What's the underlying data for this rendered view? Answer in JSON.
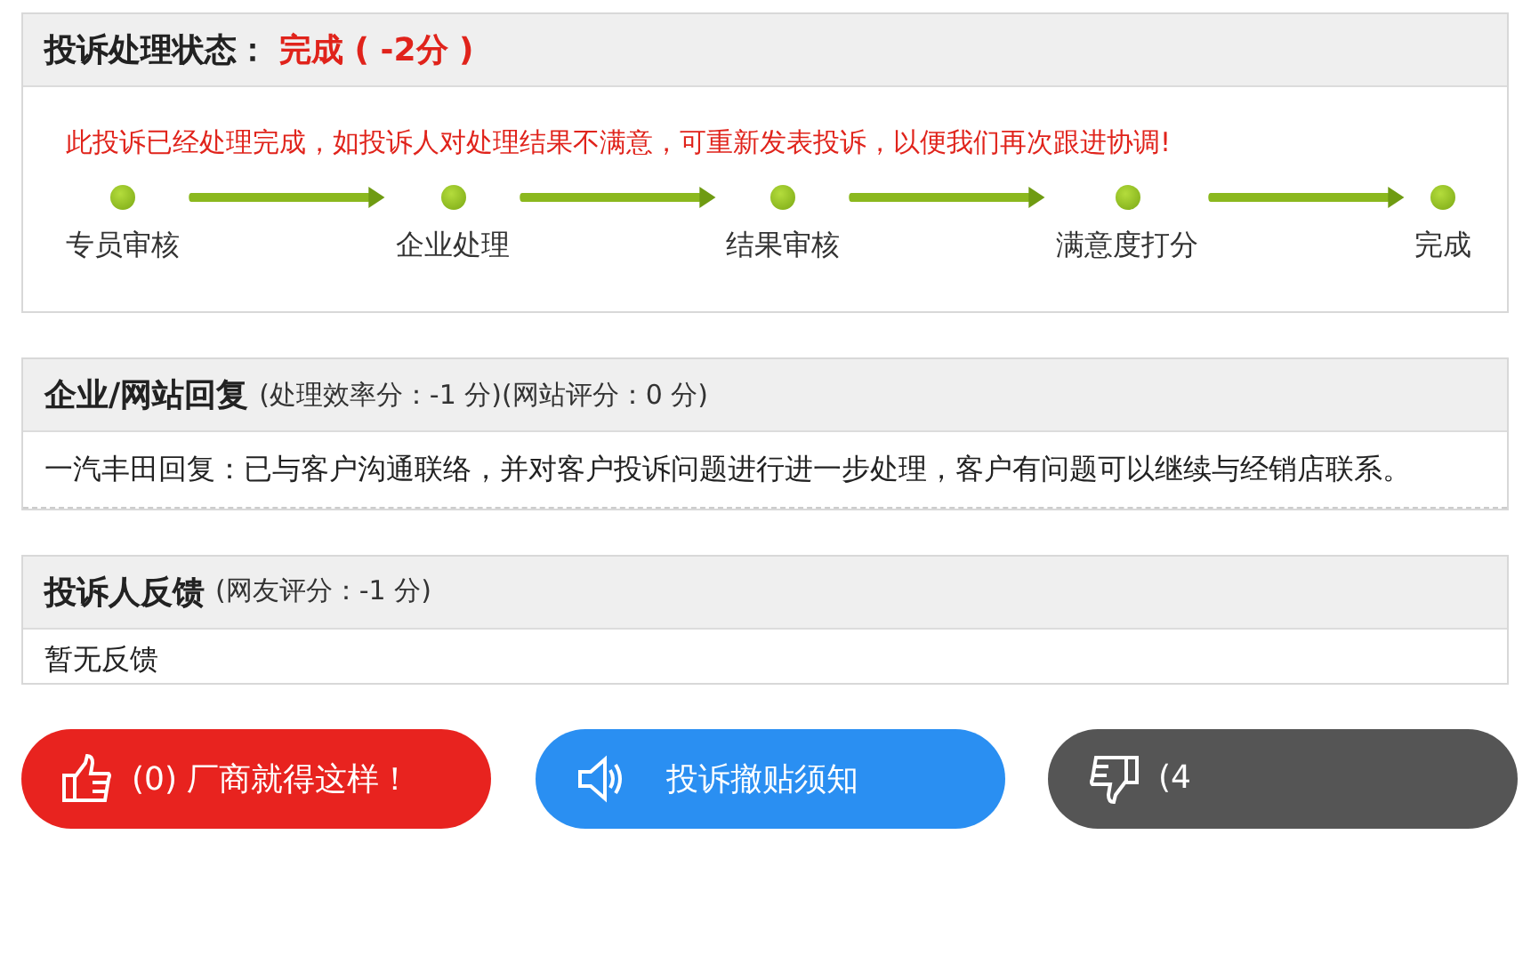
{
  "status_panel": {
    "title": "投诉处理状态：",
    "status": "完成 ( -2分 )",
    "notice": "此投诉已经处理完成，如投诉人对处理结果不满意，可重新发表投诉，以便我们再次跟进协调!",
    "steps": [
      {
        "label": "专员审核",
        "done": true
      },
      {
        "label": "企业处理",
        "done": true
      },
      {
        "label": "结果审核",
        "done": true
      },
      {
        "label": "满意度打分",
        "done": true
      },
      {
        "label": "完成",
        "done": true
      }
    ]
  },
  "reply_panel": {
    "title": "企业/网站回复",
    "scores": "(处理效率分：-1 分)(网站评分：0 分)",
    "body": "一汽丰田回复：已与客户沟通联络，并对客户投诉问题进行进一步处理，客户有问题可以继续与经销店联系。"
  },
  "feedback_panel": {
    "title": "投诉人反馈",
    "scores": "(网友评分：-1 分)",
    "body": "暂无反馈"
  },
  "buttons": [
    {
      "kind": "like",
      "label": "(0) 厂商就得这样！"
    },
    {
      "kind": "notice",
      "label": "投诉撤贴须知"
    },
    {
      "kind": "dislike",
      "label": "(4"
    }
  ]
}
